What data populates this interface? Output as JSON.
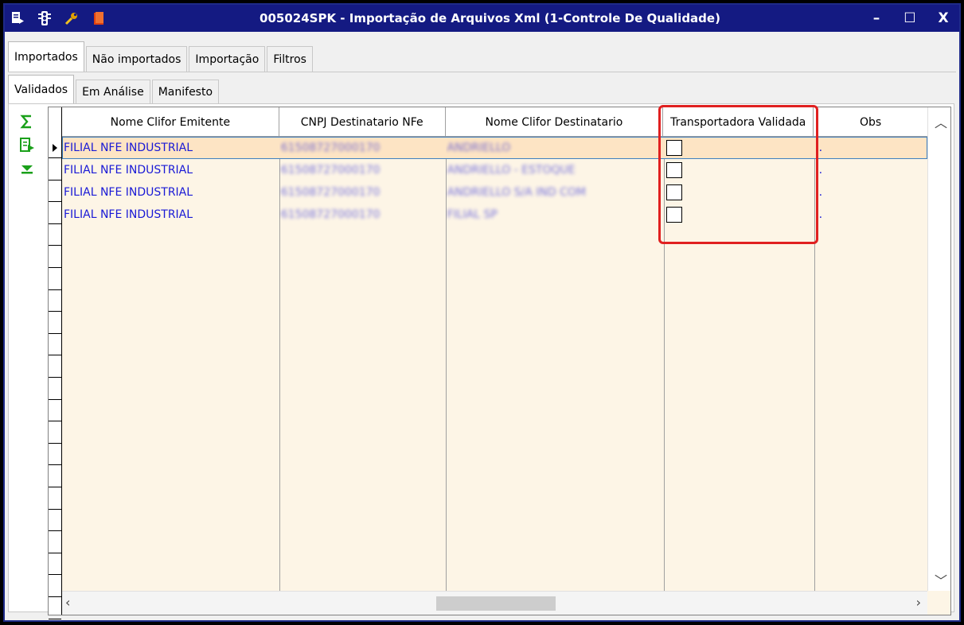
{
  "window": {
    "title": "005024SPK - Importação de Arquivos Xml (1-Controle De Qualidade)",
    "title_icons": [
      "document-arrow-icon",
      "traffic-light-icon",
      "wrench-icon",
      "book-icon"
    ],
    "controls": {
      "minimize": "–",
      "maximize": "☐",
      "close": "X"
    }
  },
  "tabs_main": [
    {
      "label": "Importados",
      "active": true
    },
    {
      "label": "Não importados",
      "active": false
    },
    {
      "label": "Importação",
      "active": false
    },
    {
      "label": "Filtros",
      "active": false
    }
  ],
  "tabs_sub": [
    {
      "label": "Validados",
      "active": true
    },
    {
      "label": "Em Análise",
      "active": false
    },
    {
      "label": "Manifesto",
      "active": false
    }
  ],
  "side_tools": [
    "sum-icon",
    "export-icon",
    "collapse-down-icon"
  ],
  "grid": {
    "columns": [
      {
        "label": "Nome Clifor Emitente"
      },
      {
        "label": "CNPJ Destinatario NFe"
      },
      {
        "label": "Nome Clifor Destinatario"
      },
      {
        "label": "Transportadora Validada"
      },
      {
        "label": "Obs"
      }
    ],
    "rows": [
      {
        "emitente": "FILIAL NFE INDUSTRIAL",
        "cnpj": "61508727000170",
        "destinatario": "ANDRIELLO",
        "transportadora_validada": false,
        "obs": "..",
        "selected": true
      },
      {
        "emitente": "FILIAL NFE INDUSTRIAL",
        "cnpj": "61508727000170",
        "destinatario": "ANDRIELLO - ESTOQUE",
        "transportadora_validada": false,
        "obs": "..",
        "selected": false
      },
      {
        "emitente": "FILIAL NFE INDUSTRIAL",
        "cnpj": "61508727000170",
        "destinatario": "ANDRIELLO S/A IND COM",
        "transportadora_validada": false,
        "obs": "..",
        "selected": false
      },
      {
        "emitente": "FILIAL NFE INDUSTRIAL",
        "cnpj": "61508727000170",
        "destinatario": "FILIAL SP",
        "transportadora_validada": false,
        "obs": "..",
        "selected": false
      }
    ]
  },
  "colors": {
    "titlebar": "#141a82",
    "grid_bg": "#fdf5e6",
    "row_text": "#1a1ad6",
    "highlight": "#e02020"
  }
}
